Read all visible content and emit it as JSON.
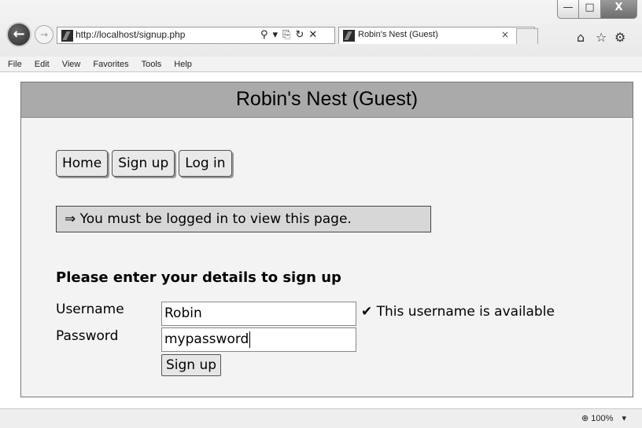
{
  "browser": {
    "url": "http://localhost/signup.php",
    "address_icons": [
      "⚲",
      "▾",
      "⎘",
      "↻",
      "✕"
    ],
    "tab_title": "Robin's Nest (Guest)",
    "tab_close": "×",
    "window_controls": {
      "minimize": "—",
      "maximize": "□",
      "close": "X"
    },
    "back": "←",
    "forward": "→",
    "home_icon": "⌂",
    "favorites_icon": "☆",
    "tools_icon": "⚙",
    "menu": [
      "File",
      "Edit",
      "View",
      "Favorites",
      "Tools",
      "Help"
    ],
    "zoom": "100%",
    "zoom_icon": "⊕",
    "zoom_arrow": "▾"
  },
  "page": {
    "title": "Robin's Nest (Guest)",
    "nav": [
      "Home",
      "Sign up",
      "Log in"
    ],
    "notice": "⇒ You must be logged in to view this page.",
    "heading": "Please enter your details to sign up",
    "form": {
      "username_label": "Username",
      "username_value": "Robin",
      "password_label": "Password",
      "password_value": "mypassword",
      "availability": "✔ This username is available",
      "submit": "Sign up"
    }
  }
}
